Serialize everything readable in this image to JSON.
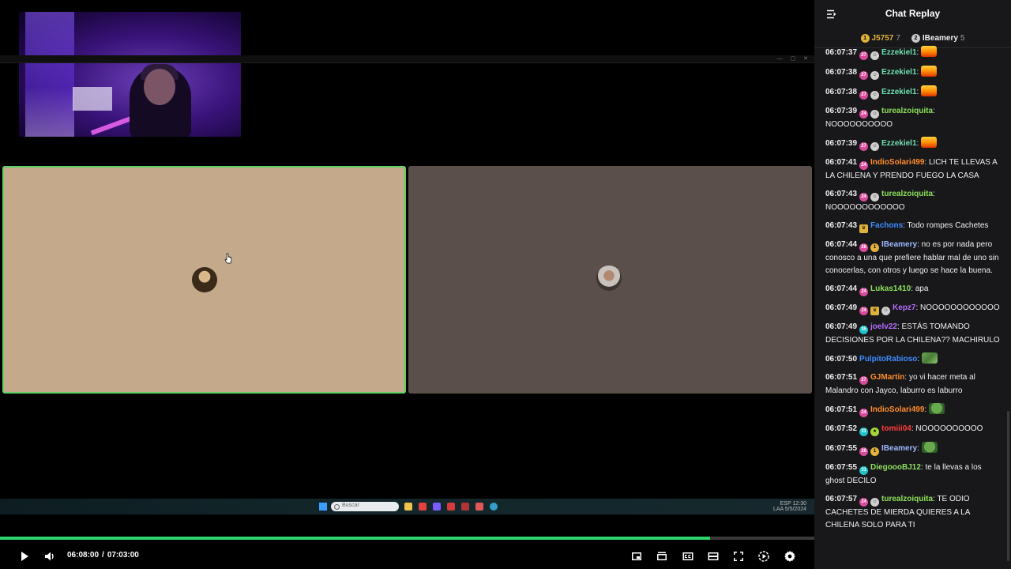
{
  "player": {
    "current_time": "06:08:00",
    "separator": "/",
    "duration": "07:03:00",
    "played_fraction": 0.872,
    "buffered_fraction": 0.868,
    "accent_color": "#2dd46a"
  },
  "desktop": {
    "search_placeholder": "Buscar",
    "tray_lang": "ESP",
    "tray_region": "LAA",
    "tray_time": "12:30",
    "tray_date": "5/5/2024"
  },
  "chat": {
    "title": "Chat Replay",
    "leaders": [
      {
        "rank": "1",
        "name": "J5757",
        "count": "7",
        "color": "#e1b23b"
      },
      {
        "rank": "2",
        "name": "IBeamery",
        "count": "5",
        "color": "#c8c8cc"
      }
    ],
    "messages": [
      {
        "ts": "06:07:37",
        "badges": [
          "sub:27",
          "face"
        ],
        "user": "Ezzekiel1",
        "color": "#6ee0b0",
        "text": "",
        "emote": "fire"
      },
      {
        "ts": "06:07:38",
        "badges": [
          "sub:27",
          "face"
        ],
        "user": "Ezzekiel1",
        "color": "#6ee0b0",
        "text": "",
        "emote": "fire"
      },
      {
        "ts": "06:07:38",
        "badges": [
          "sub:27",
          "face"
        ],
        "user": "Ezzekiel1",
        "color": "#6ee0b0",
        "text": "",
        "emote": "fire"
      },
      {
        "ts": "06:07:39",
        "badges": [
          "sub:24",
          "face"
        ],
        "user": "turealzoiquita",
        "color": "#8de05a",
        "text": "NOOOOOOOOOO",
        "emote": ""
      },
      {
        "ts": "06:07:39",
        "badges": [
          "sub:27",
          "face"
        ],
        "user": "Ezzekiel1",
        "color": "#6ee0b0",
        "text": "",
        "emote": "fire"
      },
      {
        "ts": "06:07:41",
        "badges": [
          "sub:24"
        ],
        "user": "IndioSolari499",
        "color": "#ff8c2a",
        "text": "LICH TE LLEVAS A LA CHILENA Y PRENDO FUEGO LA CASA",
        "emote": ""
      },
      {
        "ts": "06:07:43",
        "badges": [
          "sub:24",
          "face"
        ],
        "user": "turealzoiquita",
        "color": "#8de05a",
        "text": "NOOOOOOOOOOOO",
        "emote": ""
      },
      {
        "ts": "06:07:43",
        "badges": [
          "crown"
        ],
        "user": "Fachons",
        "color": "#3d8cff",
        "text": "Todo rompes Cachetes",
        "emote": ""
      },
      {
        "ts": "06:07:44",
        "badges": [
          "sub:28",
          "gold:1"
        ],
        "user": "IBeamery",
        "color": "#9ab8ff",
        "text": "no es por nada pero conosco a una que prefiere hablar mal de uno sin conocerlas, con otros y luego se hace la buena.",
        "emote": ""
      },
      {
        "ts": "06:07:44",
        "badges": [
          "sub:24"
        ],
        "user": "Lukas1410",
        "color": "#8de05a",
        "text": "apa",
        "emote": ""
      },
      {
        "ts": "06:07:49",
        "badges": [
          "sub:24",
          "crown",
          "face"
        ],
        "user": "Kepz7",
        "color": "#b56dff",
        "text": "NOOOOOOOOOOOO",
        "emote": ""
      },
      {
        "ts": "06:07:49",
        "badges": [
          "cyan:35"
        ],
        "user": "joelv22",
        "color": "#b56dff",
        "text": "ESTÁS TOMANDO DECISIONES POR LA CHILENA?? MACHIRULO",
        "emote": ""
      },
      {
        "ts": "06:07:50",
        "badges": [],
        "user": "PulpitoRabioso",
        "color": "#3d8cff",
        "text": "",
        "emote": "map"
      },
      {
        "ts": "06:07:51",
        "badges": [
          "sub:27"
        ],
        "user": "GJMartin",
        "color": "#ff8c2a",
        "text": "yo vi hacer meta al Malandro con Jayco, laburro es laburro",
        "emote": ""
      },
      {
        "ts": "06:07:51",
        "badges": [
          "sub:24"
        ],
        "user": "IndioSolari499",
        "color": "#ff8c2a",
        "text": "",
        "emote": "pepe"
      },
      {
        "ts": "06:07:52",
        "badges": [
          "cyan:31",
          "green"
        ],
        "user": "tomiii04",
        "color": "#ff3d3d",
        "text": "NOOOOOOOOOO",
        "emote": ""
      },
      {
        "ts": "06:07:55",
        "badges": [
          "sub:28",
          "gold:1"
        ],
        "user": "IBeamery",
        "color": "#9ab8ff",
        "text": "",
        "emote": "pepe"
      },
      {
        "ts": "06:07:55",
        "badges": [
          "cyan:31"
        ],
        "user": "DiegoooBJ12",
        "color": "#8de05a",
        "text": "te la llevas a los ghost DECILO",
        "emote": ""
      },
      {
        "ts": "06:07:57",
        "badges": [
          "sub:24",
          "face"
        ],
        "user": "turealzoiquita",
        "color": "#8de05a",
        "text": "TE ODIO CACHETES DE MIERDA QUIERES A LA CHILENA SOLO PARA TI",
        "emote": ""
      }
    ]
  }
}
